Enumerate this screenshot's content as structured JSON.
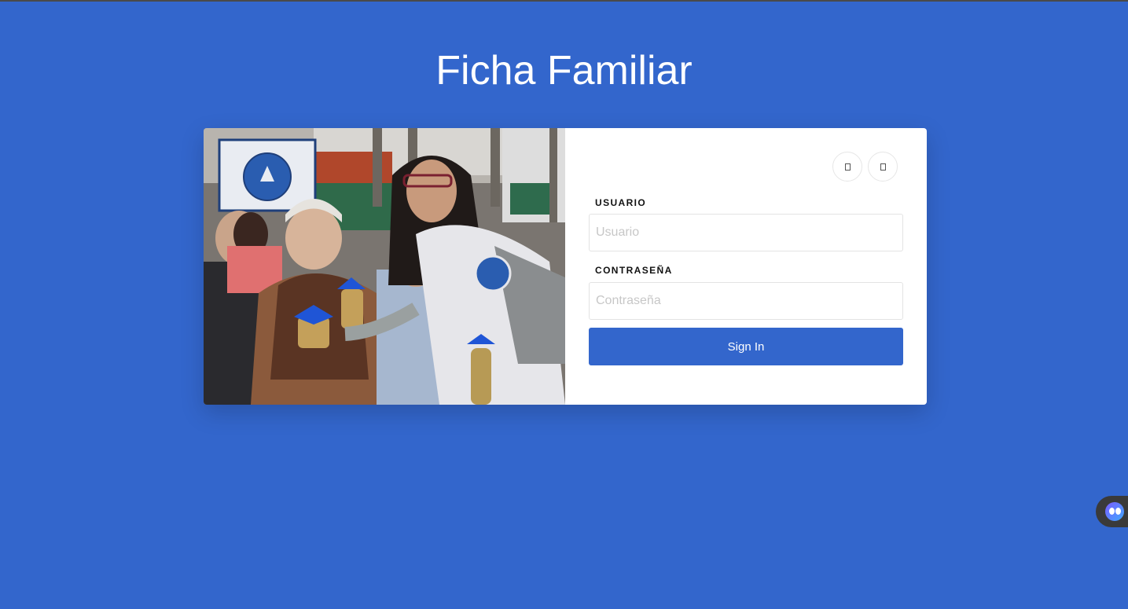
{
  "page": {
    "title": "Ficha Familiar"
  },
  "login": {
    "username_label": "USUARIO",
    "username_placeholder": "Usuario",
    "username_value": "",
    "password_label": "CONTRASEÑA",
    "password_placeholder": "Contraseña",
    "password_value": "",
    "submit_label": "Sign In",
    "social_buttons": [
      {
        "icon": "square-icon"
      },
      {
        "icon": "square-icon"
      }
    ]
  },
  "hero_image": {
    "subject": "volunteer-with-elderly-women-photo"
  },
  "colors": {
    "background": "#3366cc",
    "button": "#3366cc",
    "card": "#ffffff"
  }
}
